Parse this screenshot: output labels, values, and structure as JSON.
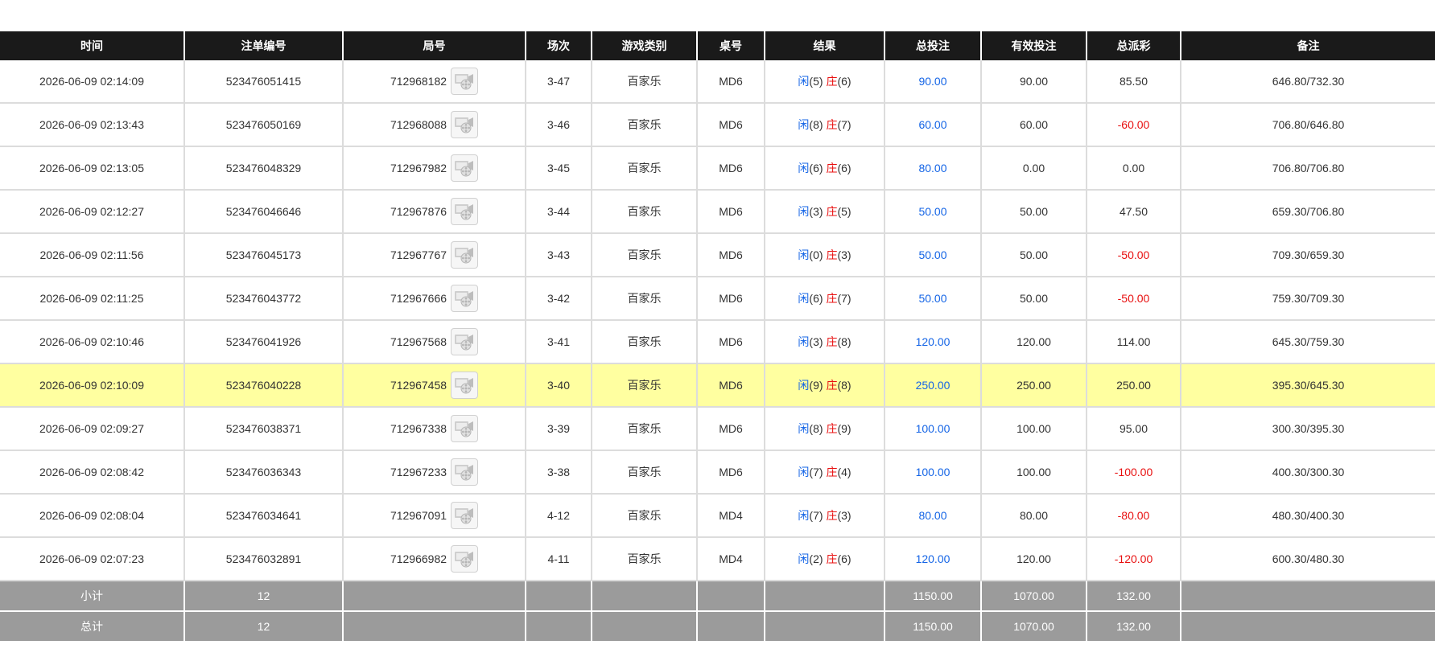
{
  "headers": [
    "时间",
    "注单编号",
    "局号",
    "场次",
    "游戏类别",
    "桌号",
    "结果",
    "总投注",
    "有效投注",
    "总派彩",
    "备注"
  ],
  "result_labels": {
    "player": "闲",
    "banker": "庄"
  },
  "icons": {
    "replay": "film-reel-icon"
  },
  "colors": {
    "header_bg": "#1a1a1a",
    "footer_bg": "#9b9b9b",
    "highlight": "#ffffa0",
    "blue": "#1565e6",
    "red": "#e81010"
  },
  "rows": [
    {
      "time": "2026-06-09 02:14:09",
      "bet_id": "523476051415",
      "round_id": "712968182",
      "session": "3-47",
      "game": "百家乐",
      "table": "MD6",
      "player": "(5)",
      "banker": "(6)",
      "total_bet": "90.00",
      "valid_bet": "90.00",
      "payout": "85.50",
      "payout_neg": false,
      "note": "646.80/732.30",
      "highlight": false
    },
    {
      "time": "2026-06-09 02:13:43",
      "bet_id": "523476050169",
      "round_id": "712968088",
      "session": "3-46",
      "game": "百家乐",
      "table": "MD6",
      "player": "(8)",
      "banker": "(7)",
      "total_bet": "60.00",
      "valid_bet": "60.00",
      "payout": "-60.00",
      "payout_neg": true,
      "note": "706.80/646.80",
      "highlight": false
    },
    {
      "time": "2026-06-09 02:13:05",
      "bet_id": "523476048329",
      "round_id": "712967982",
      "session": "3-45",
      "game": "百家乐",
      "table": "MD6",
      "player": "(6)",
      "banker": "(6)",
      "total_bet": "80.00",
      "valid_bet": "0.00",
      "payout": "0.00",
      "payout_neg": false,
      "note": "706.80/706.80",
      "highlight": false
    },
    {
      "time": "2026-06-09 02:12:27",
      "bet_id": "523476046646",
      "round_id": "712967876",
      "session": "3-44",
      "game": "百家乐",
      "table": "MD6",
      "player": "(3)",
      "banker": "(5)",
      "total_bet": "50.00",
      "valid_bet": "50.00",
      "payout": "47.50",
      "payout_neg": false,
      "note": "659.30/706.80",
      "highlight": false
    },
    {
      "time": "2026-06-09 02:11:56",
      "bet_id": "523476045173",
      "round_id": "712967767",
      "session": "3-43",
      "game": "百家乐",
      "table": "MD6",
      "player": "(0)",
      "banker": "(3)",
      "total_bet": "50.00",
      "valid_bet": "50.00",
      "payout": "-50.00",
      "payout_neg": true,
      "note": "709.30/659.30",
      "highlight": false
    },
    {
      "time": "2026-06-09 02:11:25",
      "bet_id": "523476043772",
      "round_id": "712967666",
      "session": "3-42",
      "game": "百家乐",
      "table": "MD6",
      "player": "(6)",
      "banker": "(7)",
      "total_bet": "50.00",
      "valid_bet": "50.00",
      "payout": "-50.00",
      "payout_neg": true,
      "note": "759.30/709.30",
      "highlight": false
    },
    {
      "time": "2026-06-09 02:10:46",
      "bet_id": "523476041926",
      "round_id": "712967568",
      "session": "3-41",
      "game": "百家乐",
      "table": "MD6",
      "player": "(3)",
      "banker": "(8)",
      "total_bet": "120.00",
      "valid_bet": "120.00",
      "payout": "114.00",
      "payout_neg": false,
      "note": "645.30/759.30",
      "highlight": false
    },
    {
      "time": "2026-06-09 02:10:09",
      "bet_id": "523476040228",
      "round_id": "712967458",
      "session": "3-40",
      "game": "百家乐",
      "table": "MD6",
      "player": "(9)",
      "banker": "(8)",
      "total_bet": "250.00",
      "valid_bet": "250.00",
      "payout": "250.00",
      "payout_neg": false,
      "note": "395.30/645.30",
      "highlight": true
    },
    {
      "time": "2026-06-09 02:09:27",
      "bet_id": "523476038371",
      "round_id": "712967338",
      "session": "3-39",
      "game": "百家乐",
      "table": "MD6",
      "player": "(8)",
      "banker": "(9)",
      "total_bet": "100.00",
      "valid_bet": "100.00",
      "payout": "95.00",
      "payout_neg": false,
      "note": "300.30/395.30",
      "highlight": false
    },
    {
      "time": "2026-06-09 02:08:42",
      "bet_id": "523476036343",
      "round_id": "712967233",
      "session": "3-38",
      "game": "百家乐",
      "table": "MD6",
      "player": "(7)",
      "banker": "(4)",
      "total_bet": "100.00",
      "valid_bet": "100.00",
      "payout": "-100.00",
      "payout_neg": true,
      "note": "400.30/300.30",
      "highlight": false
    },
    {
      "time": "2026-06-09 02:08:04",
      "bet_id": "523476034641",
      "round_id": "712967091",
      "session": "4-12",
      "game": "百家乐",
      "table": "MD4",
      "player": "(7)",
      "banker": "(3)",
      "total_bet": "80.00",
      "valid_bet": "80.00",
      "payout": "-80.00",
      "payout_neg": true,
      "note": "480.30/400.30",
      "highlight": false
    },
    {
      "time": "2026-06-09 02:07:23",
      "bet_id": "523476032891",
      "round_id": "712966982",
      "session": "4-11",
      "game": "百家乐",
      "table": "MD4",
      "player": "(2)",
      "banker": "(6)",
      "total_bet": "120.00",
      "valid_bet": "120.00",
      "payout": "-120.00",
      "payout_neg": true,
      "note": "600.30/480.30",
      "highlight": false
    }
  ],
  "footer": [
    {
      "label": "小计",
      "count": "12",
      "total_bet": "1150.00",
      "valid_bet": "1070.00",
      "payout": "132.00"
    },
    {
      "label": "总计",
      "count": "12",
      "total_bet": "1150.00",
      "valid_bet": "1070.00",
      "payout": "132.00"
    }
  ]
}
